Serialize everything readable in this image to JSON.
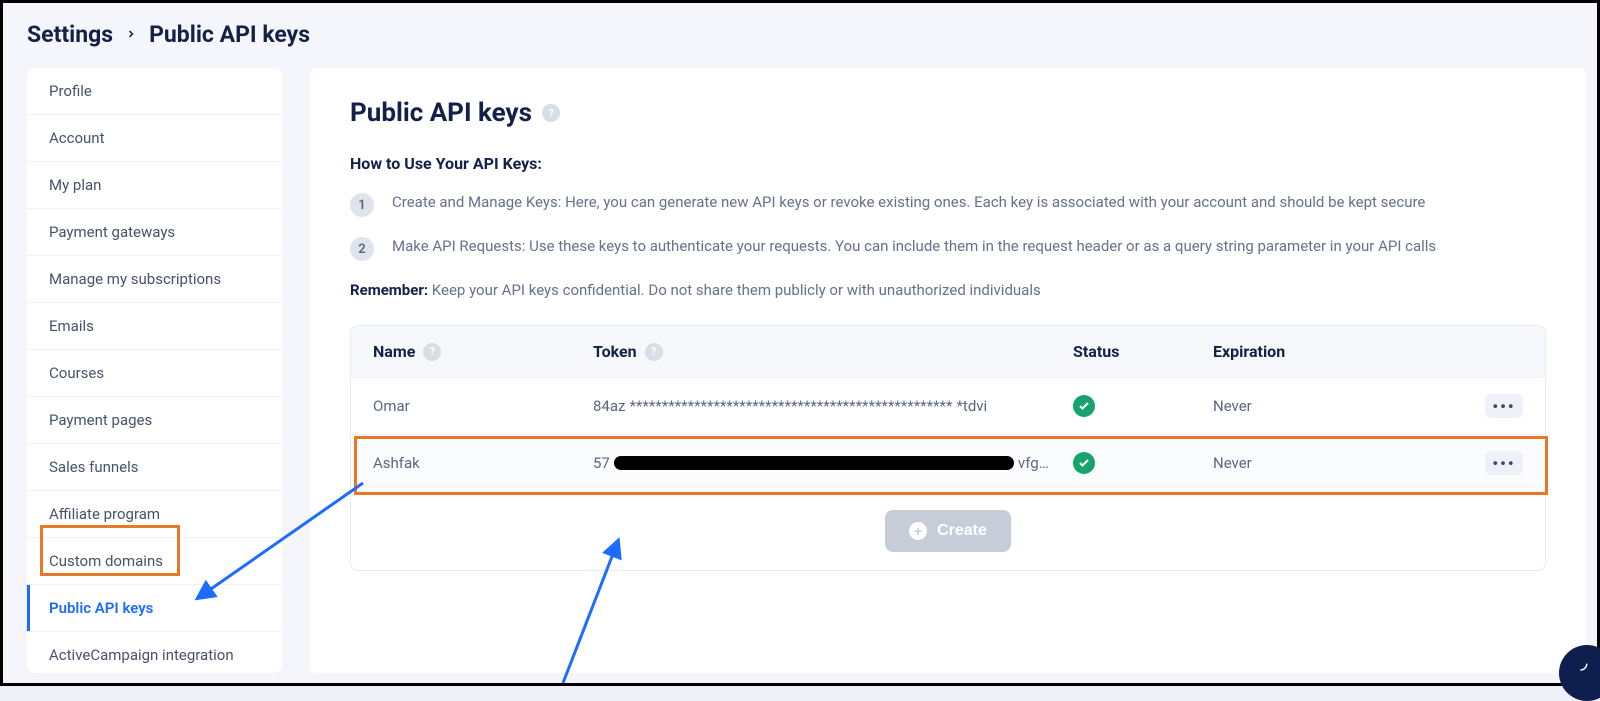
{
  "breadcrumb": {
    "root": "Settings",
    "current": "Public API keys"
  },
  "sidebar": {
    "items": [
      {
        "label": "Profile"
      },
      {
        "label": "Account"
      },
      {
        "label": "My plan"
      },
      {
        "label": "Payment gateways"
      },
      {
        "label": "Manage my subscriptions"
      },
      {
        "label": "Emails"
      },
      {
        "label": "Courses"
      },
      {
        "label": "Payment pages"
      },
      {
        "label": "Sales funnels"
      },
      {
        "label": "Affiliate program"
      },
      {
        "label": "Custom domains"
      },
      {
        "label": "Public API keys",
        "active": true
      },
      {
        "label": "ActiveCampaign integration"
      }
    ]
  },
  "main": {
    "title": "Public API keys",
    "howto_heading": "How to Use Your API Keys:",
    "steps": [
      "Create and Manage Keys: Here, you can generate new API keys or revoke existing ones. Each key is associated with your account and should be kept secure",
      "Make API Requests: Use these keys to authenticate your requests. You can include them in the request header or as a query string parameter in your API calls"
    ],
    "remember_label": "Remember:",
    "remember_text": "Keep your API keys confidential. Do not share them publicly or with unauthorized individuals",
    "table": {
      "headers": {
        "name": "Name",
        "token": "Token",
        "status": "Status",
        "expiration": "Expiration"
      },
      "rows": [
        {
          "name": "Omar",
          "token_prefix": "84az",
          "token_mask": "**************************************************",
          "token_suffix": "*tdvi",
          "status": "active",
          "expiration": "Never"
        },
        {
          "name": "Ashfak",
          "token_prefix": "57",
          "token_redacted": true,
          "token_suffix": "vfg…",
          "status": "active",
          "expiration": "Never"
        }
      ]
    },
    "create_label": "Create"
  }
}
